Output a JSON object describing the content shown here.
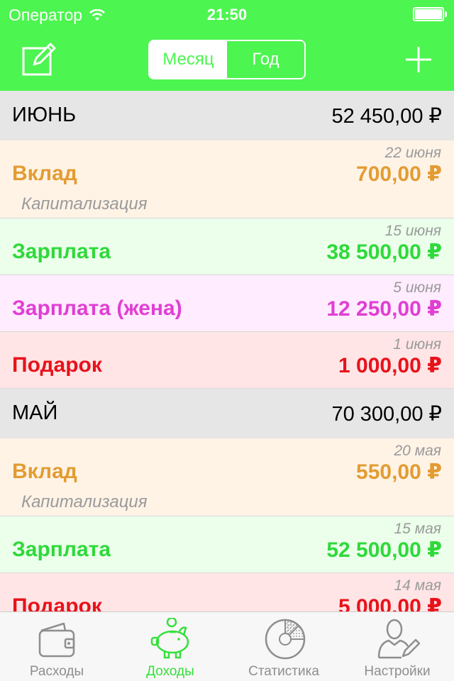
{
  "status_bar": {
    "carrier": "Оператор",
    "time": "21:50"
  },
  "nav": {
    "segments": [
      "Месяц",
      "Год"
    ],
    "selected_segment": "Месяц"
  },
  "colors": {
    "accent": "#4cf54f",
    "header_bg": "#4cf54f",
    "month_bg": "#e6e6e6",
    "tab_inactive": "#8e8e8e"
  },
  "months": [
    {
      "name": "ИЮНЬ",
      "total": "52 450,00 ₽",
      "entries": [
        {
          "date": "22 июня",
          "title": "Вклад",
          "amount": "700,00 ₽",
          "note": "Капитализация",
          "color": "#e39c32",
          "bg": "#fff3e6"
        },
        {
          "date": "15 июня",
          "title": "Зарплата",
          "amount": "38 500,00 ₽",
          "note": "",
          "color": "#2fd93a",
          "bg": "#ebffeb"
        },
        {
          "date": "5 июня",
          "title": "Зарплата (жена)",
          "amount": "12 250,00 ₽",
          "note": "",
          "color": "#e03fd4",
          "bg": "#ffecff"
        },
        {
          "date": "1 июня",
          "title": "Подарок",
          "amount": "1 000,00 ₽",
          "note": "",
          "color": "#e8121b",
          "bg": "#ffe5e5"
        }
      ]
    },
    {
      "name": "МАЙ",
      "total": "70 300,00 ₽",
      "entries": [
        {
          "date": "20 мая",
          "title": "Вклад",
          "amount": "550,00 ₽",
          "note": "Капитализация",
          "color": "#e39c32",
          "bg": "#fff3e6"
        },
        {
          "date": "15 мая",
          "title": "Зарплата",
          "amount": "52 500,00 ₽",
          "note": "",
          "color": "#2fd93a",
          "bg": "#ebffeb"
        },
        {
          "date": "14 мая",
          "title": "Подарок",
          "amount": "5 000,00 ₽",
          "note": "",
          "color": "#e8121b",
          "bg": "#ffe5e5"
        }
      ]
    }
  ],
  "tabs": [
    {
      "label": "Расходы",
      "icon": "wallet-icon",
      "active": false
    },
    {
      "label": "Доходы",
      "icon": "piggy-bank-icon",
      "active": true
    },
    {
      "label": "Статистика",
      "icon": "pie-chart-icon",
      "active": false
    },
    {
      "label": "Настройки",
      "icon": "user-settings-icon",
      "active": false
    }
  ]
}
